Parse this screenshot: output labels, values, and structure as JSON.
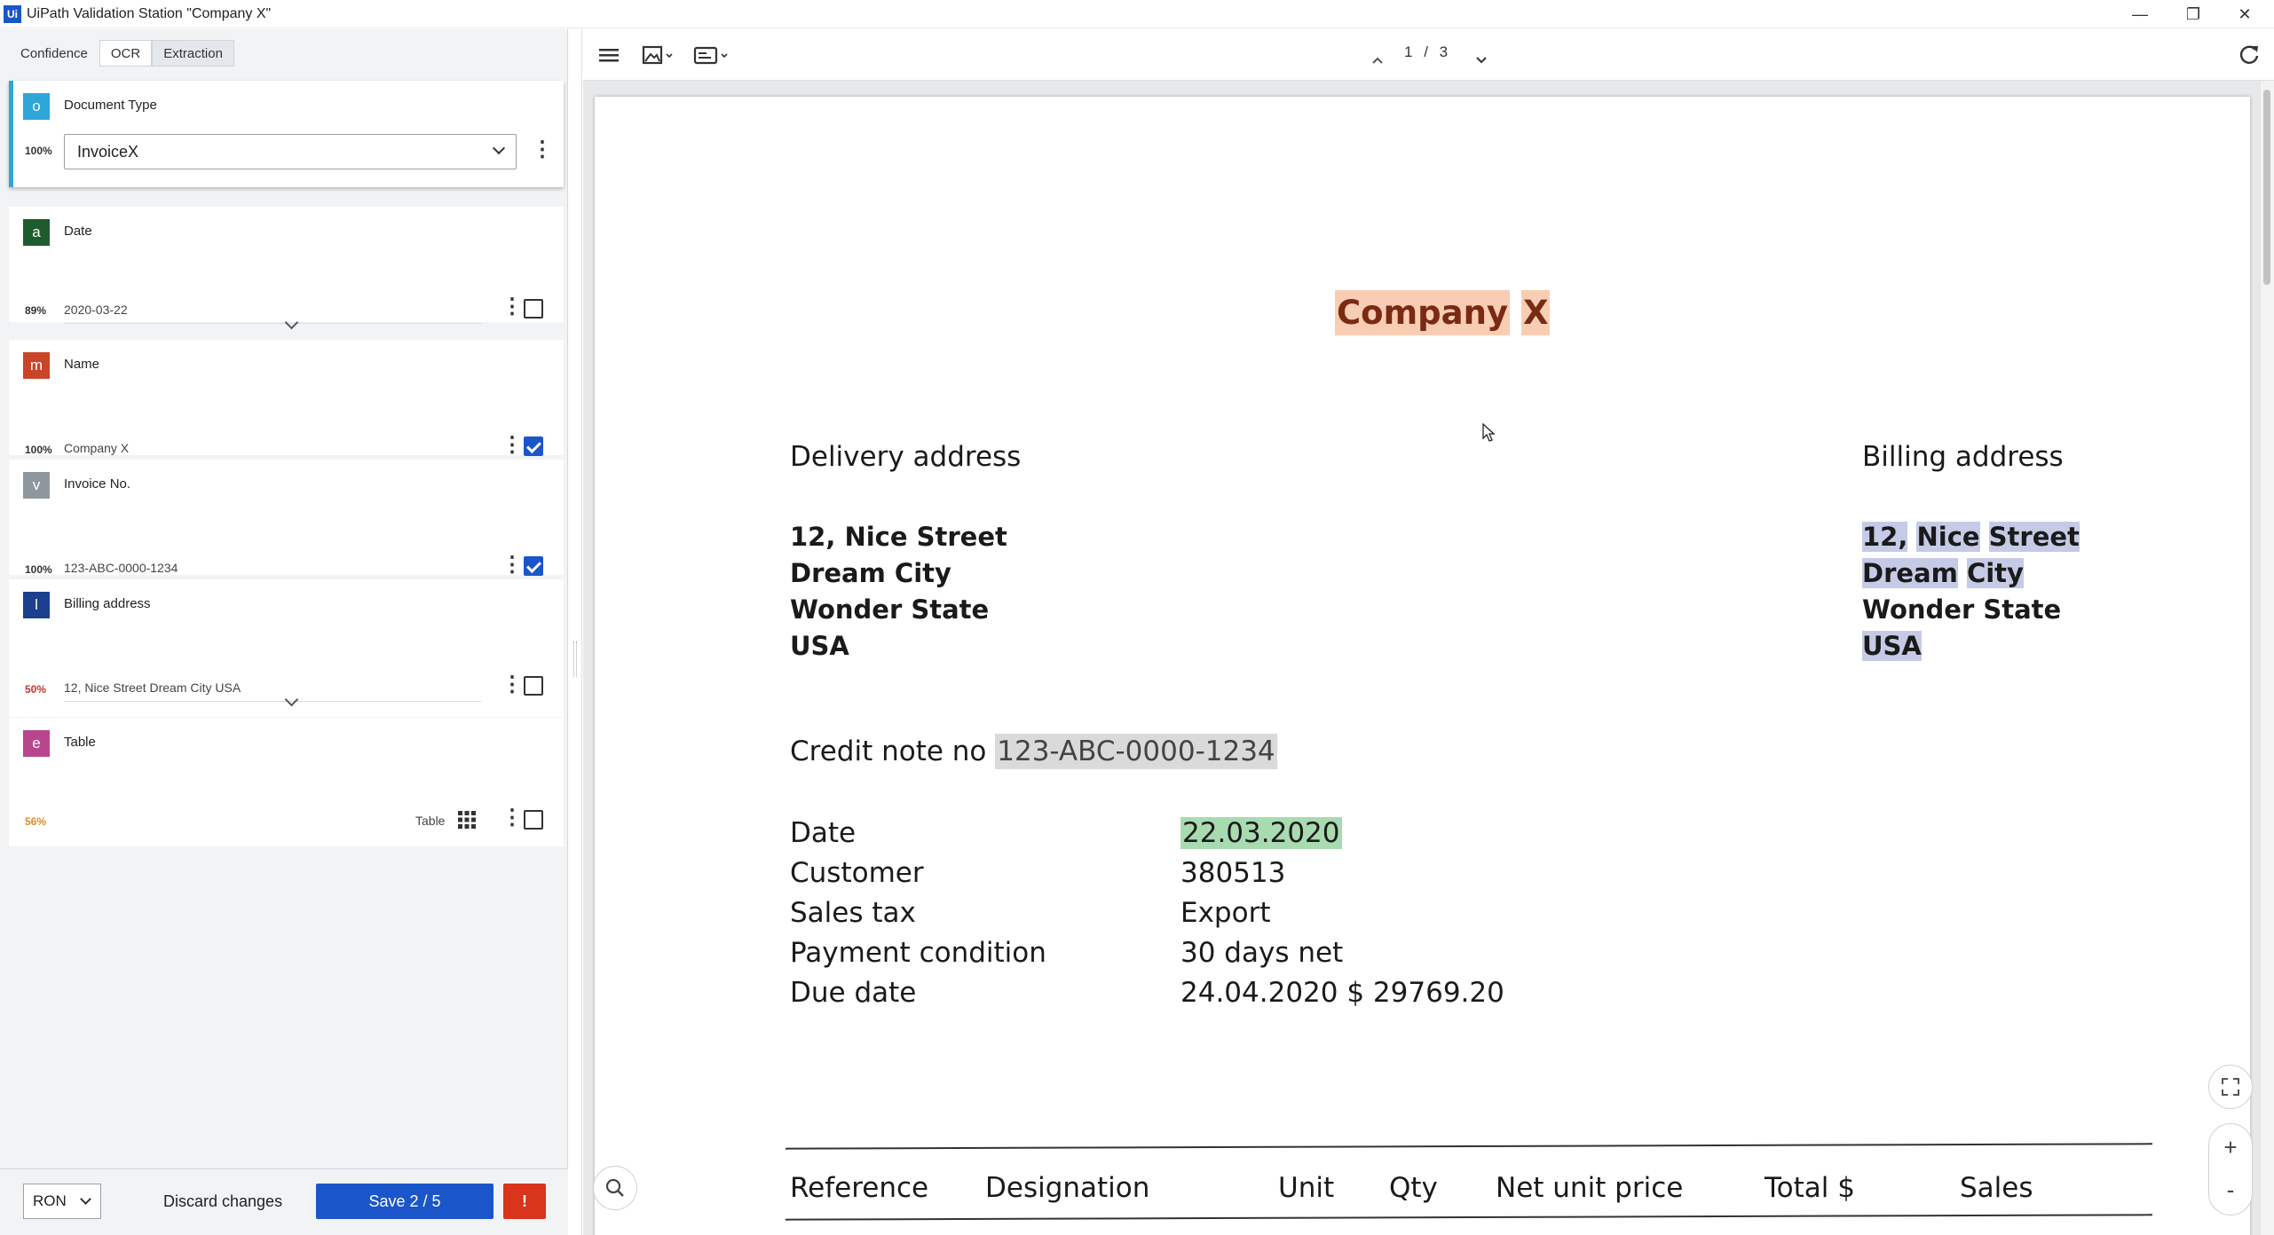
{
  "window": {
    "logo": "Ui",
    "title": "UiPath Validation Station \"Company X\"",
    "controls": {
      "minimize": "—",
      "restore": "❐",
      "close": "✕"
    }
  },
  "tabs": [
    {
      "label": "Confidence"
    },
    {
      "label": "OCR"
    },
    {
      "label": "Extraction"
    }
  ],
  "fields": {
    "document_type": {
      "letter": "o",
      "title": "Document Type",
      "confidence": "100%",
      "value": "InvoiceX",
      "color": "#2fa6d8"
    },
    "date": {
      "letter": "a",
      "title": "Date",
      "confidence": "89%",
      "value": "2020-03-22",
      "color": "#1e5c2e",
      "checked": false
    },
    "name": {
      "letter": "m",
      "title": "Name",
      "confidence": "100%",
      "value": "Company X",
      "color": "#c9452a",
      "checked": true
    },
    "invoice_no": {
      "letter": "v",
      "title": "Invoice No.",
      "confidence": "100%",
      "value": "123-ABC-0000-1234",
      "color": "#8f979e",
      "checked": true
    },
    "billing_address": {
      "letter": "l",
      "title": "Billing address",
      "confidence": "50%",
      "value": "12, Nice Street Dream City USA",
      "color": "#1c3f8f",
      "checked": false
    },
    "table": {
      "letter": "e",
      "title": "Table",
      "confidence": "56%",
      "value": "Table",
      "color": "#b8468c",
      "checked": false
    }
  },
  "bottom": {
    "currency": "RON",
    "discard": "Discard changes",
    "save": "Save 2 / 5",
    "alert": "!"
  },
  "viewer": {
    "page_current": "1",
    "page_sep": "/",
    "page_total": "3"
  },
  "document": {
    "company_part1": "Company",
    "company_part2": "X",
    "delivery_heading": "Delivery address",
    "billing_heading": "Billing address",
    "delivery_lines": [
      "12, Nice Street",
      "Dream City",
      "Wonder State",
      "USA"
    ],
    "billing": {
      "l1a": "12,",
      "l1b": "Nice",
      "l1c": "Street",
      "l2a": "Dream",
      "l2b": "City",
      "l3": "Wonder State",
      "l4": "USA"
    },
    "credit_label": "Credit note no",
    "credit_value": "123-ABC-0000-1234",
    "details": [
      {
        "label": "Date",
        "value": "22.03.2020"
      },
      {
        "label": "Customer",
        "value": "380513"
      },
      {
        "label": "Sales tax",
        "value": "Export"
      },
      {
        "label": "Payment condition",
        "value": "30 days net"
      },
      {
        "label": "Due date",
        "value": "24.04.2020 $ 29769.20"
      }
    ],
    "table_headers": [
      "Reference",
      "Designation",
      "Unit",
      "Qty",
      "Net unit price",
      "Total $",
      "Sales"
    ]
  }
}
